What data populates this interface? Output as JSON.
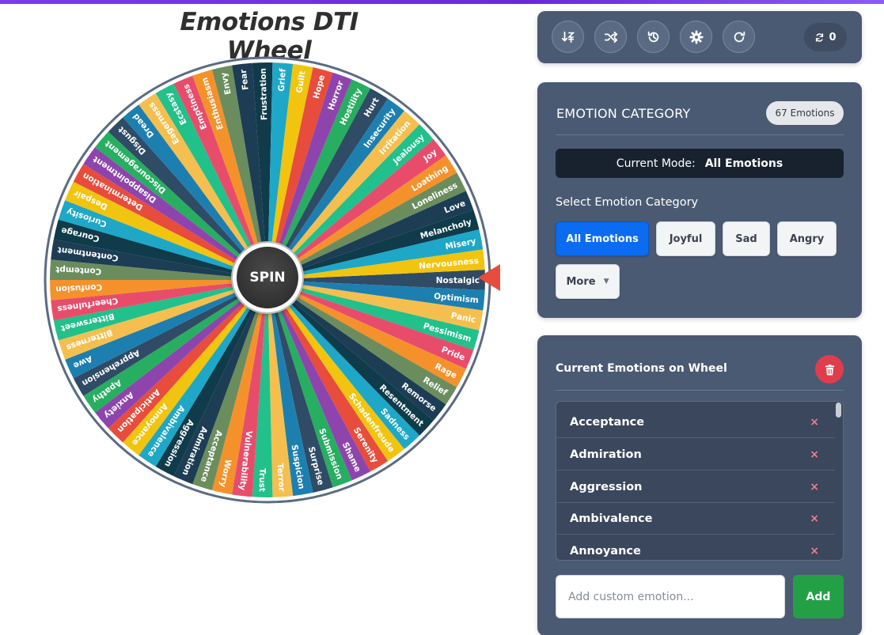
{
  "page": {
    "title": "Emotions DTI Wheel"
  },
  "wheel": {
    "spin_label": "SPIN",
    "pointer_at": "Nostalgic",
    "palette": [
      "#2f4b66",
      "#1d7fb0",
      "#f4bf4f",
      "#22c08a",
      "#e84c6b",
      "#f5912b",
      "#6b8d5e",
      "#1c3d54",
      "#0f3b4a",
      "#1ea7c7",
      "#f1c40f",
      "#e74c3c",
      "#8e44ad",
      "#27ae60"
    ],
    "segments": [
      "Nostalgic",
      "Optimism",
      "Panic",
      "Pessimism",
      "Pride",
      "Rage",
      "Relief",
      "Remorse",
      "Resentment",
      "Sadness",
      "Schadenfreude",
      "Serenity",
      "Shame",
      "Submission",
      "Surprise",
      "Suspicion",
      "Terror",
      "Trust",
      "Vulnerability",
      "Worry",
      "Acceptance",
      "Admiration",
      "Aggression",
      "Ambivalence",
      "Annoyance",
      "Anticipation",
      "Anxiety",
      "Apathy",
      "Apprehension",
      "Awe",
      "Bitterness",
      "Bittersweet",
      "Cheerfulness",
      "Confusion",
      "Contempt",
      "Contentment",
      "Courage",
      "Curiosity",
      "Despair",
      "Determination",
      "Disappointment",
      "Discouragement",
      "Disgust",
      "Dread",
      "Eagerness",
      "Ecstasy",
      "Emptiness",
      "Enthusiasm",
      "Envy",
      "Fear",
      "Frustration",
      "Grief",
      "Guilt",
      "Hope",
      "Horror",
      "Hostility",
      "Hurt",
      "Insecurity",
      "Irritation",
      "Jealousy",
      "Joy",
      "Loathing",
      "Loneliness",
      "Love",
      "Melancholy",
      "Misery",
      "Nervousness"
    ]
  },
  "toolbar": {
    "icons": [
      "sort-icon",
      "shuffle-icon",
      "history-icon",
      "gear-icon",
      "redo-icon"
    ],
    "counter_value": "0"
  },
  "category": {
    "heading": "EMOTION CATEGORY",
    "count_badge": "67 Emotions",
    "mode_label": "Current Mode:",
    "mode_value": "All Emotions",
    "select_label": "Select Emotion Category",
    "buttons": [
      {
        "label": "All Emotions",
        "active": true
      },
      {
        "label": "Joyful",
        "active": false
      },
      {
        "label": "Sad",
        "active": false
      },
      {
        "label": "Angry",
        "active": false
      },
      {
        "label": "More",
        "active": false
      }
    ]
  },
  "current": {
    "heading": "Current Emotions on Wheel",
    "items": [
      "Acceptance",
      "Admiration",
      "Aggression",
      "Ambivalence",
      "Annoyance"
    ],
    "remove_glyph": "×",
    "add_placeholder": "Add custom emotion...",
    "add_label": "Add"
  },
  "colors": {
    "accent_blue": "#0b6cf2",
    "panel": "#4b5a73",
    "add_green": "#23a046",
    "delete_red": "#e03d4c",
    "pointer": "#e74c3c"
  }
}
